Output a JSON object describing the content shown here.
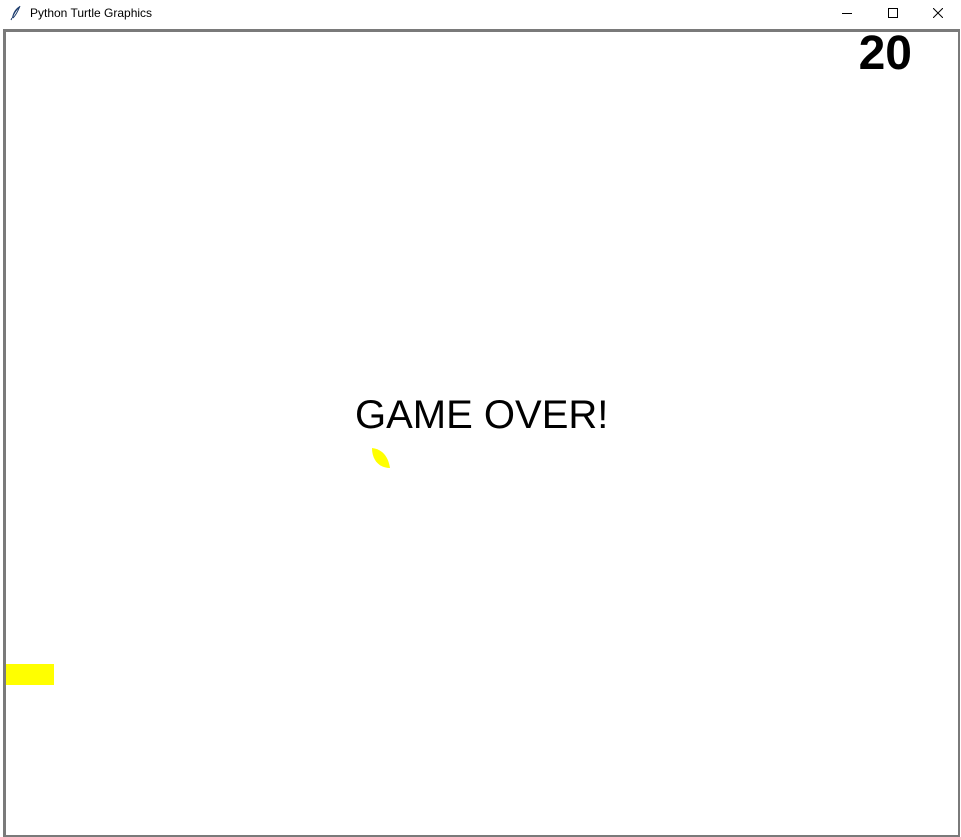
{
  "window": {
    "title": "Python Turtle Graphics",
    "controls": {
      "minimize": "minimize-icon",
      "maximize": "maximize-icon",
      "close": "close-icon"
    }
  },
  "game": {
    "score": "20",
    "message": "GAME OVER!",
    "colors": {
      "background": "#ffffff",
      "snake": "#ffff00",
      "food": "#ffff00",
      "text": "#000000"
    }
  }
}
